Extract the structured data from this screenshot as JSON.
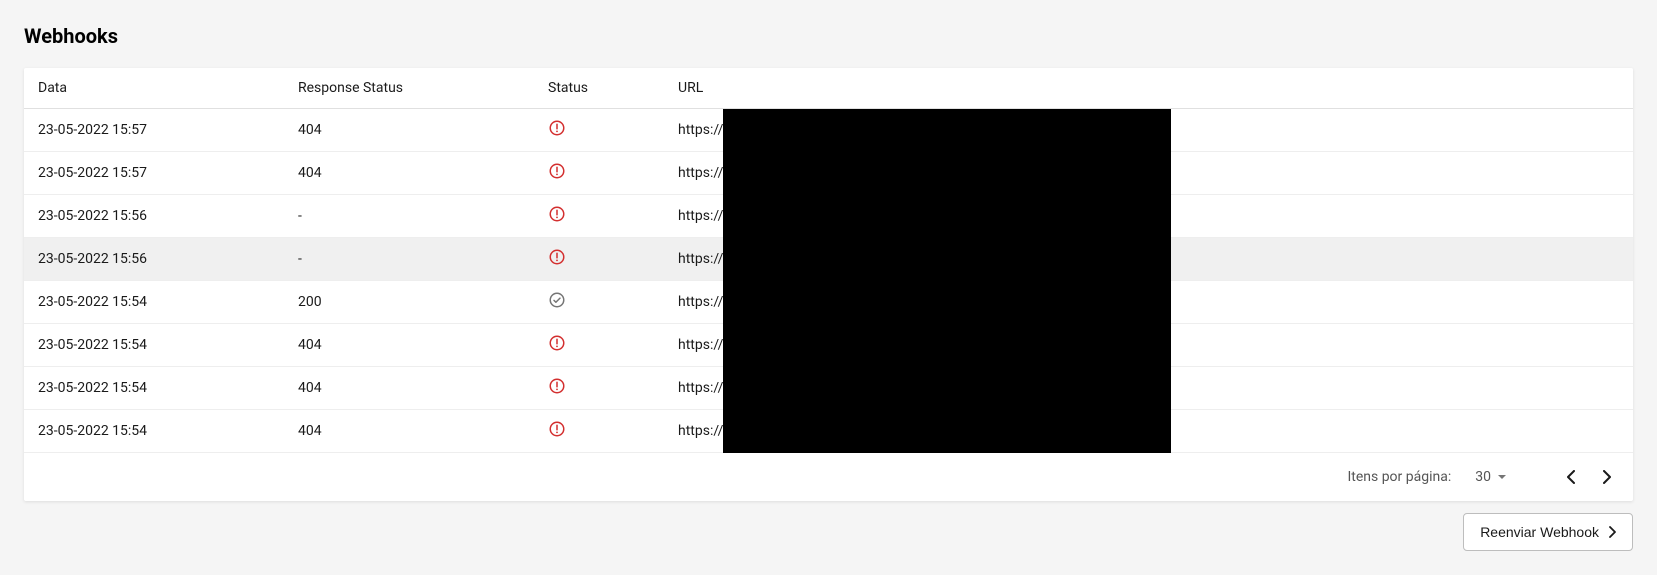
{
  "page": {
    "title": "Webhooks"
  },
  "table": {
    "headers": {
      "data": "Data",
      "response_status": "Response Status",
      "status": "Status",
      "url": "URL"
    },
    "rows": [
      {
        "data": "23-05-2022 15:57",
        "response_status": "404",
        "status": "error",
        "url": "https://",
        "selected": false
      },
      {
        "data": "23-05-2022 15:57",
        "response_status": "404",
        "status": "error",
        "url": "https://",
        "selected": false
      },
      {
        "data": "23-05-2022 15:56",
        "response_status": "-",
        "status": "error",
        "url": "https://",
        "selected": false
      },
      {
        "data": "23-05-2022 15:56",
        "response_status": "-",
        "status": "error",
        "url": "https://",
        "selected": true
      },
      {
        "data": "23-05-2022 15:54",
        "response_status": "200",
        "status": "success",
        "url": "https://",
        "selected": false
      },
      {
        "data": "23-05-2022 15:54",
        "response_status": "404",
        "status": "error",
        "url": "https://",
        "selected": false
      },
      {
        "data": "23-05-2022 15:54",
        "response_status": "404",
        "status": "error",
        "url": "https://",
        "selected": false
      },
      {
        "data": "23-05-2022 15:54",
        "response_status": "404",
        "status": "error",
        "url": "https://",
        "selected": false
      }
    ]
  },
  "pagination": {
    "items_per_page_label": "Itens por página:",
    "items_per_page_value": "30"
  },
  "actions": {
    "resend_label": "Reenviar Webhook"
  }
}
